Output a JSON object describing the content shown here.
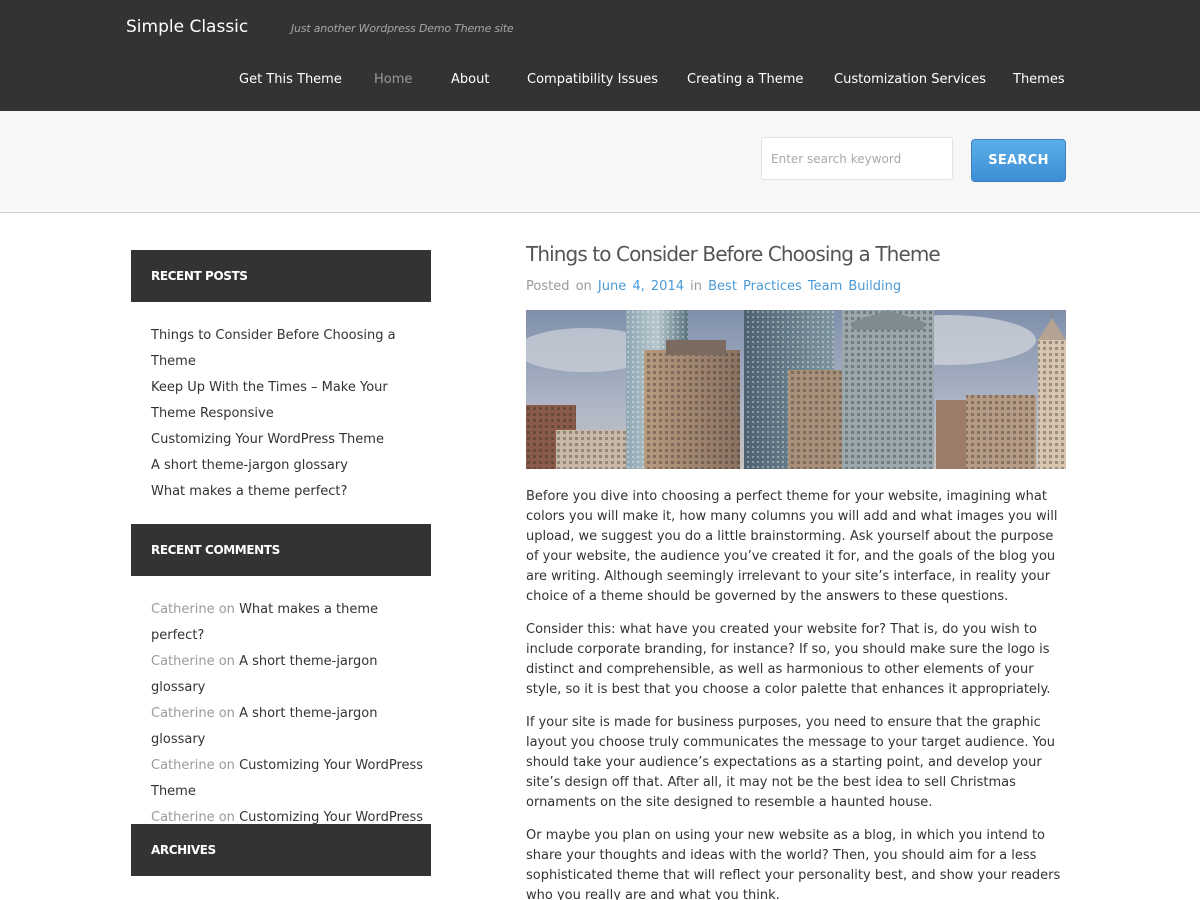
{
  "site": {
    "title": "Simple Classic",
    "tagline": "Just another Wordpress Demo Theme site"
  },
  "nav": {
    "items": [
      {
        "label": "Get This Theme"
      },
      {
        "label": "Home",
        "active": true
      },
      {
        "label": "About"
      },
      {
        "label": "Compatibility Issues"
      },
      {
        "label": "Creating a Theme"
      },
      {
        "label": "Customization Services"
      },
      {
        "label": "Themes"
      }
    ]
  },
  "search": {
    "placeholder": "Enter search keyword",
    "value": "",
    "button_label": "SEARCH"
  },
  "sidebar": {
    "recent_posts": {
      "title": "RECENT POSTS",
      "items": [
        "Things to Consider Before Choosing a Theme",
        "Keep Up With the Times – Make Your Theme Responsive",
        "Customizing Your WordPress Theme",
        "A short theme-jargon glossary",
        "What makes a theme perfect?"
      ]
    },
    "recent_comments": {
      "title": "RECENT COMMENTS",
      "on_word": "on",
      "items": [
        {
          "author": "Catherine",
          "post": "What makes a theme perfect?"
        },
        {
          "author": "Catherine",
          "post": "A short theme-jargon glossary"
        },
        {
          "author": "Catherine",
          "post": "A short theme-jargon glossary"
        },
        {
          "author": "Catherine",
          "post": "Customizing Your WordPress Theme"
        },
        {
          "author": "Catherine",
          "post": "Customizing Your WordPress Theme"
        }
      ]
    },
    "archives": {
      "title": "ARCHIVES"
    }
  },
  "post": {
    "title": "Things to Consider Before Choosing a Theme",
    "meta": {
      "posted_on": "Posted on",
      "date": "June 4, 2014",
      "in_word": "in",
      "categories": [
        "Best Practices",
        "Team Building"
      ]
    },
    "paragraphs": [
      "Before you dive into choosing a perfect theme for your website, imagining what colors you will make it, how many columns you will add and what images you will upload, we suggest you do a little brainstorming. Ask yourself about the purpose of your website, the audience you’ve created it for, and the goals of the blog you are writing. Although seemingly irrelevant to your site’s interface, in reality your choice of a theme should be governed by the answers to these questions.",
      "Consider this: what have you created your website for? That is, do you wish to include corporate branding, for instance? If so, you should make sure the logo is distinct and comprehensible, as well as harmonious to other elements of your style, so it is best that you choose a color palette that enhances it appropriately.",
      "If your site is made for business purposes, you need to ensure that the graphic layout you choose truly communicates the message to your target audience. You should take your audience’s expectations as a starting point, and develop your site’s design off that. After all, it may not be the best idea to sell Christmas ornaments on the site designed to resemble a haunted house.",
      "Or maybe you plan on using your new website as a blog, in which you intend to share your thoughts and ideas with the world? Then, you should aim for a less sophisticated theme that will reflect your personality best, and show your readers who you really are and what you think."
    ]
  },
  "colors": {
    "header_bg": "#333333",
    "accent_link": "#4a9ad8",
    "search_button": "#4a9ee0"
  }
}
